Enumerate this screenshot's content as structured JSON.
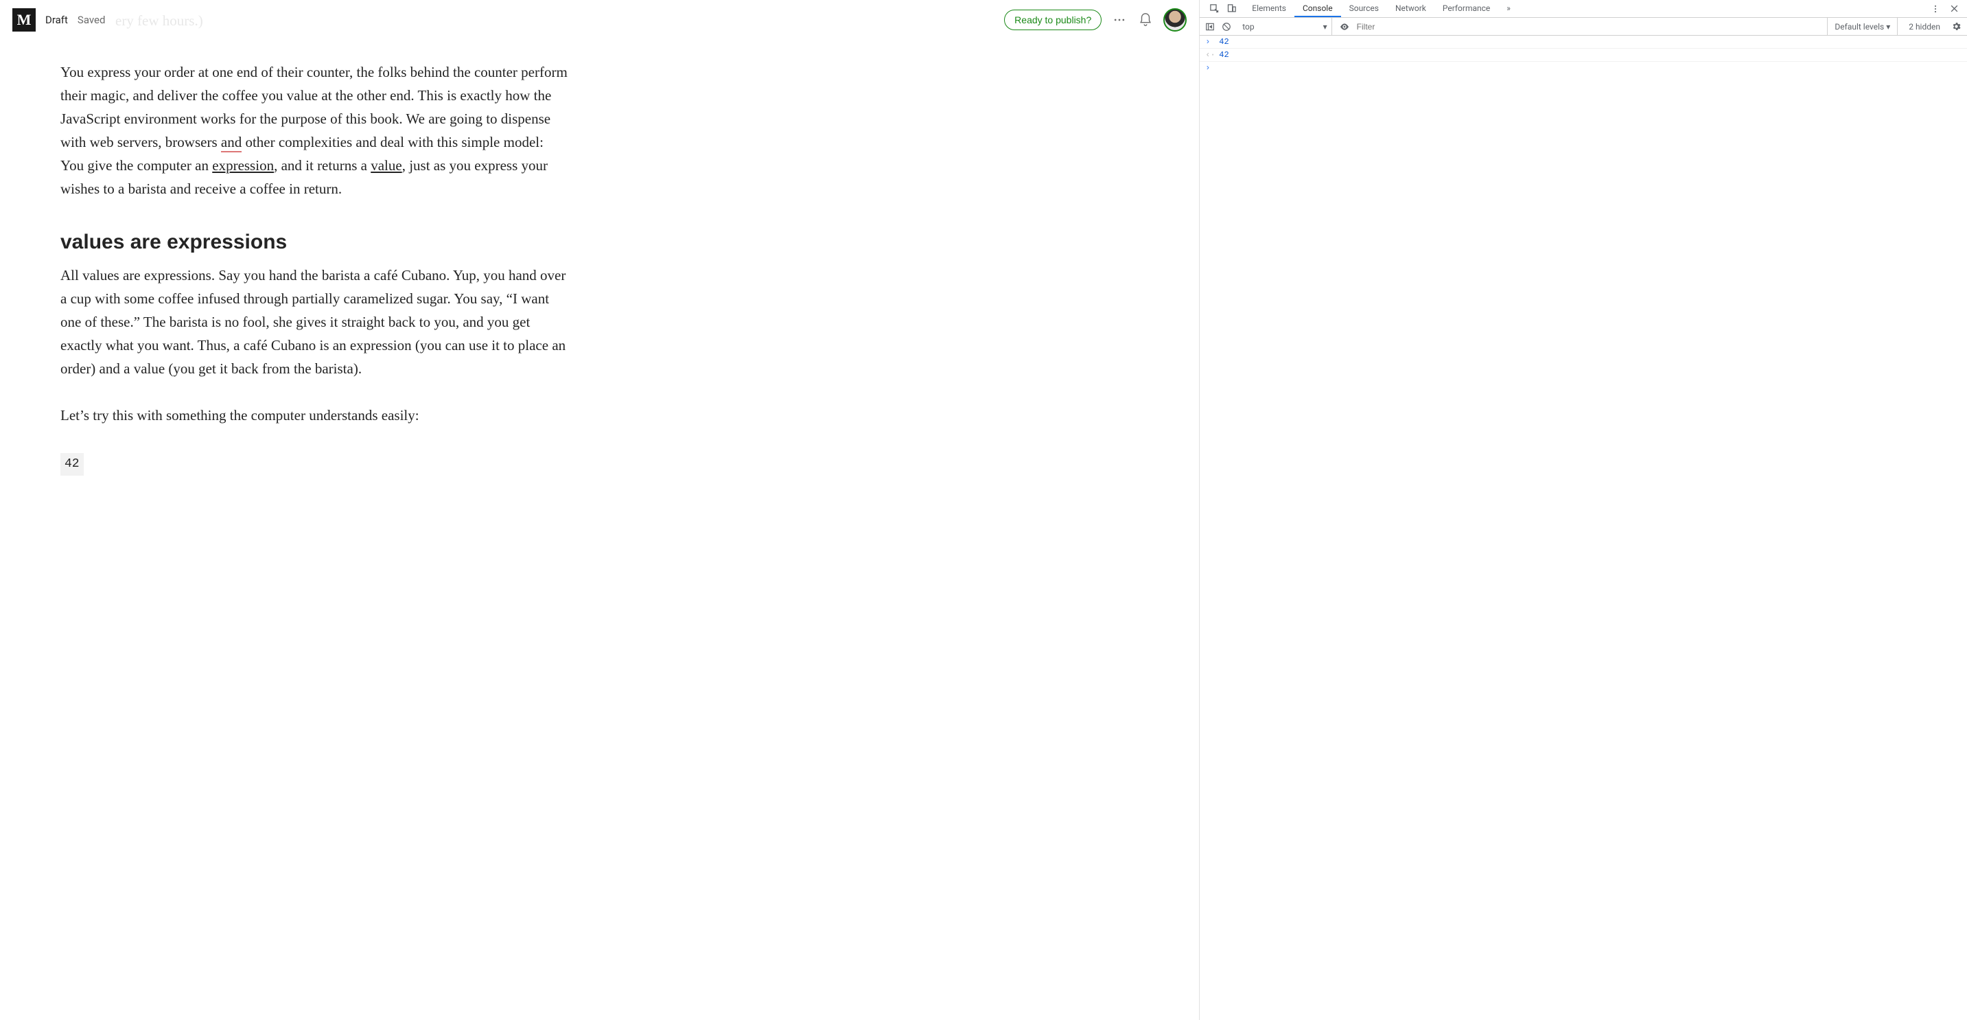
{
  "medium": {
    "logo_letter": "M",
    "status_draft": "Draft",
    "status_saved": "Saved",
    "ghost_text": "ery few hours.)",
    "publish_label": "Ready to publish?",
    "paragraph1_pre": "You express your order at one end of their counter, the folks behind the counter perform their magic, and deliver the coffee you value at the other end. This is exactly how the JavaScript environment works for the purpose of this book. We are going to dispense with web servers, browsers ",
    "p1_and": "and",
    "p1_mid": " other complexities and deal with this simple model: You give the computer an ",
    "p1_expression": "expression",
    "p1_mid2": ", and it returns a ",
    "p1_value": "value",
    "p1_tail": ", just as you express your wishes to a barista and receive a coffee in return.",
    "heading": "values are expressions",
    "paragraph2": "All values are expressions. Say you hand the barista a café Cubano. Yup, you hand over a cup with some coffee infused through partially caramelized sugar. You say, “I want one of these.” The barista is no fool, she gives it straight back to you, and you get exactly what you want. Thus, a café Cubano is an expression (you can use it to place an order) and a value (you get it back from the barista).",
    "paragraph3": "Let’s try this with something the computer understands easily:",
    "code_sample": "42"
  },
  "devtools": {
    "tabs": {
      "elements": "Elements",
      "console": "Console",
      "sources": "Sources",
      "network": "Network",
      "performance": "Performance"
    },
    "context": "top",
    "filter_placeholder": "Filter",
    "levels": "Default levels",
    "hidden": "2 hidden",
    "input_value": "42",
    "output_value": "42"
  }
}
